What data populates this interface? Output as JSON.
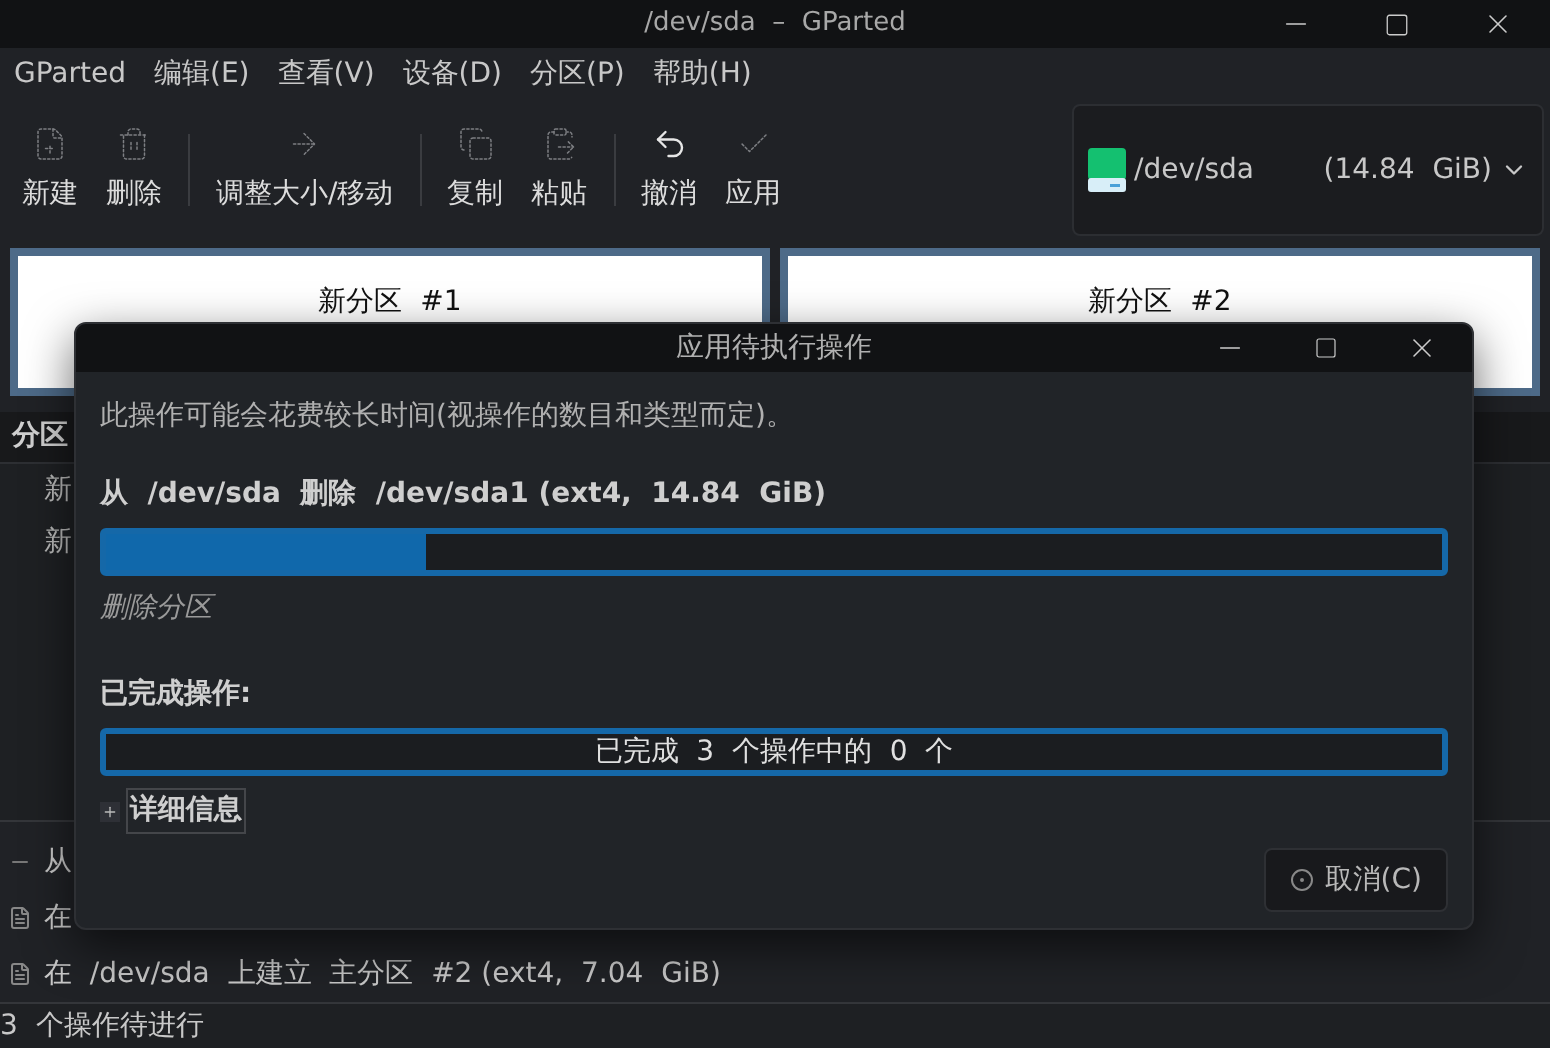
{
  "window": {
    "title": "/dev/sda  –  GParted"
  },
  "menu": [
    "GParted",
    "编辑(E)",
    "查看(V)",
    "设备(D)",
    "分区(P)",
    "帮助(H)"
  ],
  "toolbar": [
    {
      "kind": "new",
      "label": "新建",
      "disabled": true
    },
    {
      "kind": "delete",
      "label": "删除",
      "disabled": true
    },
    {
      "kind": "resize",
      "label": "调整大小/移动",
      "disabled": true
    },
    {
      "kind": "copy",
      "label": "复制",
      "disabled": true
    },
    {
      "kind": "paste",
      "label": "粘贴",
      "disabled": true
    },
    {
      "kind": "undo",
      "label": "撤消",
      "disabled": false
    },
    {
      "kind": "apply",
      "label": "应用",
      "disabled": true
    }
  ],
  "device": {
    "name": "/dev/sda",
    "size": "(14.84  GiB)"
  },
  "partitions": [
    {
      "label": "新分区  #1"
    },
    {
      "label": "新分区  #2"
    }
  ],
  "partition_list": {
    "header": "分区",
    "rows": [
      "新",
      "新"
    ]
  },
  "operations": [
    {
      "kind": "delete",
      "text": "从"
    },
    {
      "kind": "create",
      "text": "在"
    },
    {
      "kind": "create",
      "text": "在  /dev/sda  上建立  主分区  #2 (ext4,  7.04  GiB)"
    }
  ],
  "status_bar": "3  个操作待进行",
  "dialog": {
    "title": "应用待执行操作",
    "notice": "此操作可能会花费较长时间(视操作的数目和类型而定)。",
    "current_operation": "从  /dev/sda  删除  /dev/sda1 (ext4,  14.84  GiB)",
    "current_progress": {
      "level": 0.24
    },
    "current_step": "删除分区",
    "completed_label": "已完成操作:",
    "overall_progress": {
      "level": 0,
      "text": "已完成  3  个操作中的  0  个"
    },
    "details": {
      "label": "详细信息",
      "expanded": false
    },
    "cancel_button": "取消(C)"
  }
}
